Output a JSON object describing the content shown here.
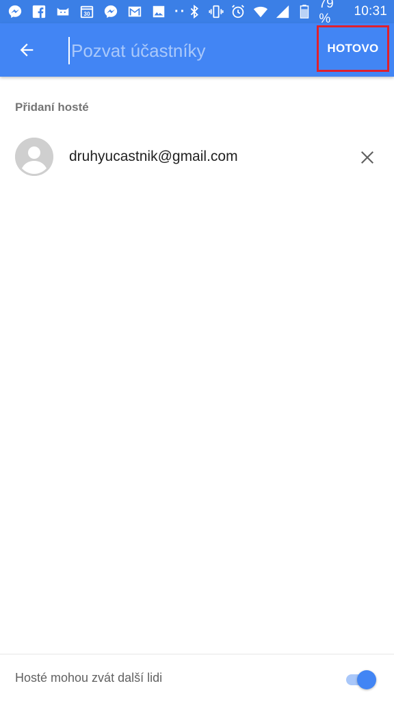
{
  "status_bar": {
    "left_icons": [
      "messenger-icon",
      "facebook-icon",
      "cat-app-icon",
      "calendar-icon",
      "messenger-icon",
      "gmail-icon",
      "gallery-icon"
    ],
    "more_dots": "··",
    "right_icons": [
      "bluetooth-icon",
      "vibrate-icon",
      "alarm-icon",
      "wifi-icon",
      "signal-icon",
      "battery-icon"
    ],
    "battery": "79 %",
    "time": "10:31"
  },
  "app_bar": {
    "background": "#4285f4",
    "input_placeholder": "Pozvat účastníky",
    "input_value": "",
    "done_label": "HOTOVO",
    "highlight_color": "#e0202c"
  },
  "guests": {
    "section_title": "Přidaní hosté",
    "items": [
      {
        "email": "druhyucastnik@gmail.com",
        "avatar": "default-avatar-icon"
      }
    ]
  },
  "footer": {
    "option_label": "Hosté mohou zvát další lidi",
    "option_enabled": true
  },
  "colors": {
    "accent": "#4285f4",
    "status_bar": "#3b7fe6"
  }
}
